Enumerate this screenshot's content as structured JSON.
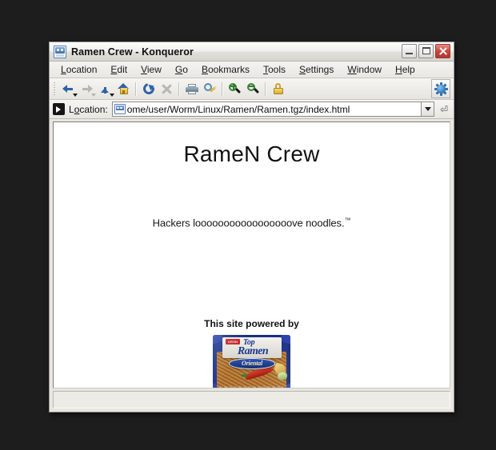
{
  "window": {
    "title": "Ramen Crew - Konqueror",
    "title_icon": "konqueror-window-icon",
    "buttons": {
      "minimize": "minimize-button",
      "maximize": "maximize-button",
      "close": "close-button"
    }
  },
  "menubar": {
    "items": [
      {
        "label": "Location",
        "accel": "L"
      },
      {
        "label": "Edit",
        "accel": "E"
      },
      {
        "label": "View",
        "accel": "V"
      },
      {
        "label": "Go",
        "accel": "G"
      },
      {
        "label": "Bookmarks",
        "accel": "B"
      },
      {
        "label": "Tools",
        "accel": "T"
      },
      {
        "label": "Settings",
        "accel": "S"
      },
      {
        "label": "Window",
        "accel": "W"
      },
      {
        "label": "Help",
        "accel": "H"
      }
    ]
  },
  "toolbar": {
    "buttons": [
      {
        "name": "back-button",
        "icon": "back-arrow-icon",
        "enabled": true
      },
      {
        "name": "forward-button",
        "icon": "forward-arrow-icon",
        "enabled": false
      },
      {
        "name": "up-button",
        "icon": "up-arrow-icon",
        "enabled": true
      },
      {
        "name": "home-button",
        "icon": "home-icon",
        "enabled": true
      },
      {
        "name": "reload-button",
        "icon": "reload-icon",
        "enabled": true
      },
      {
        "name": "stop-button",
        "icon": "stop-icon",
        "enabled": false
      },
      {
        "name": "print-button",
        "icon": "printer-icon",
        "enabled": true
      },
      {
        "name": "find-button",
        "icon": "find-magnifier-icon",
        "enabled": true
      },
      {
        "name": "zoom-in-button",
        "icon": "zoom-in-magnifier-icon",
        "enabled": true
      },
      {
        "name": "zoom-out-button",
        "icon": "zoom-out-magnifier-icon",
        "enabled": true
      },
      {
        "name": "security-button",
        "icon": "padlock-icon",
        "enabled": true
      }
    ],
    "logo": "konqueror-gear-icon"
  },
  "location_bar": {
    "clear_icon": "clear-location-icon",
    "label": "Location:",
    "label_accel": "o",
    "favicon": "page-favicon-icon",
    "value": "ome/user/Worm/Linux/Ramen/Ramen.tgz/index.html",
    "dropdown_icon": "chevron-down-icon",
    "go_icon": "go-enter-icon"
  },
  "page": {
    "heading": "RameN Crew",
    "tagline_text": "Hackers looooooooooooooooove noodles.",
    "tagline_tm": "™",
    "powered_label": "This site powered by",
    "product_image": {
      "name": "top-ramen-package-image",
      "brand_top": "Top",
      "brand_main": "Ramen",
      "brand_maker": "NISSIN",
      "flavor": "Oriental"
    }
  },
  "statusbar": {
    "text": ""
  },
  "colors": {
    "accent_blue": "#2e62a8",
    "window_bg": "#e8e6e1",
    "page_bg": "#ffffff",
    "close_red": "#c6453c",
    "desktop": "#1d1d1d",
    "ramen_blue": "#1b3a8f"
  }
}
